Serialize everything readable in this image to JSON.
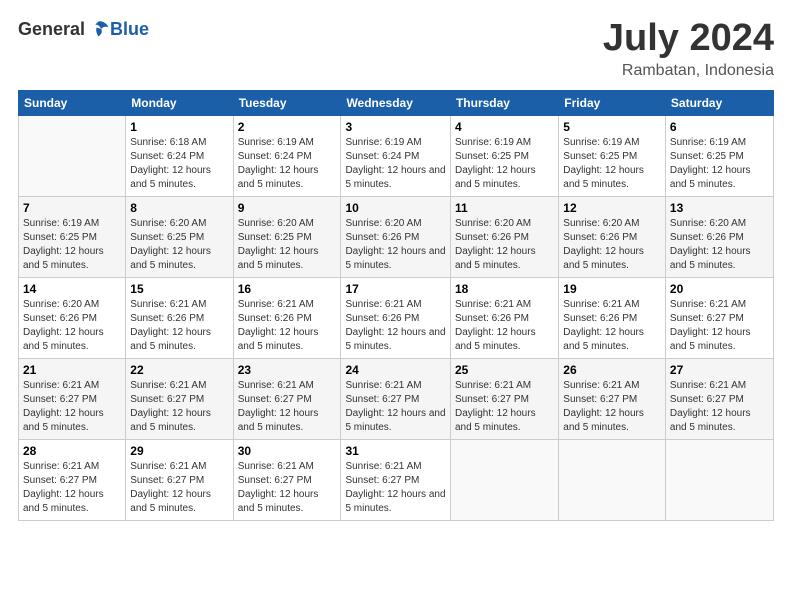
{
  "header": {
    "logo_general": "General",
    "logo_blue": "Blue",
    "title": "July 2024",
    "subtitle": "Rambatan, Indonesia"
  },
  "weekdays": [
    "Sunday",
    "Monday",
    "Tuesday",
    "Wednesday",
    "Thursday",
    "Friday",
    "Saturday"
  ],
  "weeks": [
    [
      {
        "day": "",
        "sunrise": "",
        "sunset": "",
        "daylight": ""
      },
      {
        "day": "1",
        "sunrise": "Sunrise: 6:18 AM",
        "sunset": "Sunset: 6:24 PM",
        "daylight": "Daylight: 12 hours and 5 minutes."
      },
      {
        "day": "2",
        "sunrise": "Sunrise: 6:19 AM",
        "sunset": "Sunset: 6:24 PM",
        "daylight": "Daylight: 12 hours and 5 minutes."
      },
      {
        "day": "3",
        "sunrise": "Sunrise: 6:19 AM",
        "sunset": "Sunset: 6:24 PM",
        "daylight": "Daylight: 12 hours and 5 minutes."
      },
      {
        "day": "4",
        "sunrise": "Sunrise: 6:19 AM",
        "sunset": "Sunset: 6:25 PM",
        "daylight": "Daylight: 12 hours and 5 minutes."
      },
      {
        "day": "5",
        "sunrise": "Sunrise: 6:19 AM",
        "sunset": "Sunset: 6:25 PM",
        "daylight": "Daylight: 12 hours and 5 minutes."
      },
      {
        "day": "6",
        "sunrise": "Sunrise: 6:19 AM",
        "sunset": "Sunset: 6:25 PM",
        "daylight": "Daylight: 12 hours and 5 minutes."
      }
    ],
    [
      {
        "day": "7",
        "sunrise": "Sunrise: 6:19 AM",
        "sunset": "Sunset: 6:25 PM",
        "daylight": "Daylight: 12 hours and 5 minutes."
      },
      {
        "day": "8",
        "sunrise": "Sunrise: 6:20 AM",
        "sunset": "Sunset: 6:25 PM",
        "daylight": "Daylight: 12 hours and 5 minutes."
      },
      {
        "day": "9",
        "sunrise": "Sunrise: 6:20 AM",
        "sunset": "Sunset: 6:25 PM",
        "daylight": "Daylight: 12 hours and 5 minutes."
      },
      {
        "day": "10",
        "sunrise": "Sunrise: 6:20 AM",
        "sunset": "Sunset: 6:26 PM",
        "daylight": "Daylight: 12 hours and 5 minutes."
      },
      {
        "day": "11",
        "sunrise": "Sunrise: 6:20 AM",
        "sunset": "Sunset: 6:26 PM",
        "daylight": "Daylight: 12 hours and 5 minutes."
      },
      {
        "day": "12",
        "sunrise": "Sunrise: 6:20 AM",
        "sunset": "Sunset: 6:26 PM",
        "daylight": "Daylight: 12 hours and 5 minutes."
      },
      {
        "day": "13",
        "sunrise": "Sunrise: 6:20 AM",
        "sunset": "Sunset: 6:26 PM",
        "daylight": "Daylight: 12 hours and 5 minutes."
      }
    ],
    [
      {
        "day": "14",
        "sunrise": "Sunrise: 6:20 AM",
        "sunset": "Sunset: 6:26 PM",
        "daylight": "Daylight: 12 hours and 5 minutes."
      },
      {
        "day": "15",
        "sunrise": "Sunrise: 6:21 AM",
        "sunset": "Sunset: 6:26 PM",
        "daylight": "Daylight: 12 hours and 5 minutes."
      },
      {
        "day": "16",
        "sunrise": "Sunrise: 6:21 AM",
        "sunset": "Sunset: 6:26 PM",
        "daylight": "Daylight: 12 hours and 5 minutes."
      },
      {
        "day": "17",
        "sunrise": "Sunrise: 6:21 AM",
        "sunset": "Sunset: 6:26 PM",
        "daylight": "Daylight: 12 hours and 5 minutes."
      },
      {
        "day": "18",
        "sunrise": "Sunrise: 6:21 AM",
        "sunset": "Sunset: 6:26 PM",
        "daylight": "Daylight: 12 hours and 5 minutes."
      },
      {
        "day": "19",
        "sunrise": "Sunrise: 6:21 AM",
        "sunset": "Sunset: 6:26 PM",
        "daylight": "Daylight: 12 hours and 5 minutes."
      },
      {
        "day": "20",
        "sunrise": "Sunrise: 6:21 AM",
        "sunset": "Sunset: 6:27 PM",
        "daylight": "Daylight: 12 hours and 5 minutes."
      }
    ],
    [
      {
        "day": "21",
        "sunrise": "Sunrise: 6:21 AM",
        "sunset": "Sunset: 6:27 PM",
        "daylight": "Daylight: 12 hours and 5 minutes."
      },
      {
        "day": "22",
        "sunrise": "Sunrise: 6:21 AM",
        "sunset": "Sunset: 6:27 PM",
        "daylight": "Daylight: 12 hours and 5 minutes."
      },
      {
        "day": "23",
        "sunrise": "Sunrise: 6:21 AM",
        "sunset": "Sunset: 6:27 PM",
        "daylight": "Daylight: 12 hours and 5 minutes."
      },
      {
        "day": "24",
        "sunrise": "Sunrise: 6:21 AM",
        "sunset": "Sunset: 6:27 PM",
        "daylight": "Daylight: 12 hours and 5 minutes."
      },
      {
        "day": "25",
        "sunrise": "Sunrise: 6:21 AM",
        "sunset": "Sunset: 6:27 PM",
        "daylight": "Daylight: 12 hours and 5 minutes."
      },
      {
        "day": "26",
        "sunrise": "Sunrise: 6:21 AM",
        "sunset": "Sunset: 6:27 PM",
        "daylight": "Daylight: 12 hours and 5 minutes."
      },
      {
        "day": "27",
        "sunrise": "Sunrise: 6:21 AM",
        "sunset": "Sunset: 6:27 PM",
        "daylight": "Daylight: 12 hours and 5 minutes."
      }
    ],
    [
      {
        "day": "28",
        "sunrise": "Sunrise: 6:21 AM",
        "sunset": "Sunset: 6:27 PM",
        "daylight": "Daylight: 12 hours and 5 minutes."
      },
      {
        "day": "29",
        "sunrise": "Sunrise: 6:21 AM",
        "sunset": "Sunset: 6:27 PM",
        "daylight": "Daylight: 12 hours and 5 minutes."
      },
      {
        "day": "30",
        "sunrise": "Sunrise: 6:21 AM",
        "sunset": "Sunset: 6:27 PM",
        "daylight": "Daylight: 12 hours and 5 minutes."
      },
      {
        "day": "31",
        "sunrise": "Sunrise: 6:21 AM",
        "sunset": "Sunset: 6:27 PM",
        "daylight": "Daylight: 12 hours and 5 minutes."
      },
      {
        "day": "",
        "sunrise": "",
        "sunset": "",
        "daylight": ""
      },
      {
        "day": "",
        "sunrise": "",
        "sunset": "",
        "daylight": ""
      },
      {
        "day": "",
        "sunrise": "",
        "sunset": "",
        "daylight": ""
      }
    ]
  ]
}
